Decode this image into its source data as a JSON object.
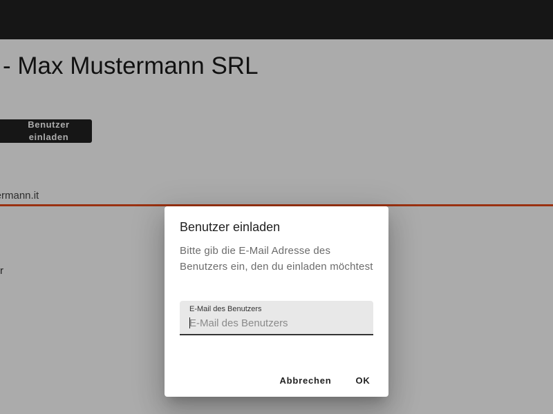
{
  "page": {
    "title": "- Max Mustermann SRL",
    "invite_button_label": "Benutzer einladen",
    "email_fragment": "stermann.it",
    "side_fragment": "r"
  },
  "colors": {
    "topbar": "#212121",
    "tab_indicator": "#e64a19",
    "overlay": "rgba(0,0,0,0.33)"
  },
  "dialog": {
    "title": "Benutzer einladen",
    "text": "Bitte gib die E-Mail Adresse des Benutzers ein, den du einladen möchtest",
    "field": {
      "label": "E-Mail des Benutzers",
      "placeholder": "E-Mail des Benutzers",
      "value": ""
    },
    "cancel_label": "Abbrechen",
    "ok_label": "OK"
  }
}
